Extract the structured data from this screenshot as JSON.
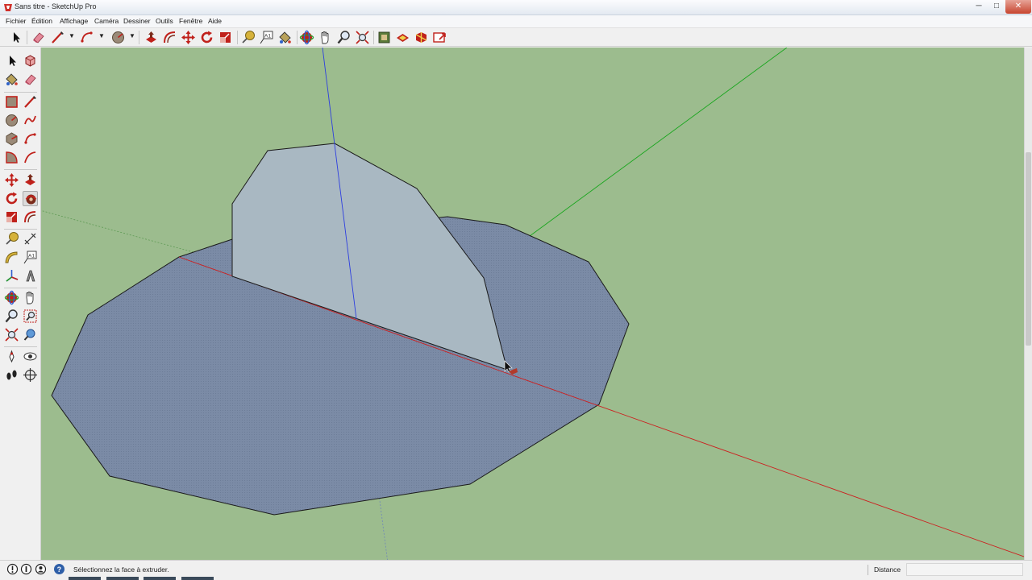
{
  "window": {
    "title": "Sans titre - SketchUp Pro",
    "min_glyph": "─",
    "max_glyph": "□",
    "close_glyph": "✕"
  },
  "menu": {
    "items": [
      {
        "label": "Fichier"
      },
      {
        "label": "Édition"
      },
      {
        "label": "Affichage"
      },
      {
        "label": "Caméra"
      },
      {
        "label": "Dessiner"
      },
      {
        "label": "Outils"
      },
      {
        "label": "Fenêtre"
      },
      {
        "label": "Aide"
      }
    ]
  },
  "toolbar": {
    "tools": [
      {
        "name": "select-tool-icon"
      },
      {
        "name": "eraser-icon"
      },
      {
        "name": "line-tool-icon"
      },
      {
        "name": "line-dropdown-icon"
      },
      {
        "name": "arc-tool-icon"
      },
      {
        "name": "arc-dropdown-icon"
      },
      {
        "name": "shape-tool-icon"
      },
      {
        "name": "shape-dropdown-icon"
      },
      {
        "name": "push-pull-icon"
      },
      {
        "name": "offset-icon"
      },
      {
        "name": "move-icon"
      },
      {
        "name": "rotate-icon"
      },
      {
        "name": "scale-icon"
      },
      {
        "name": "tape-measure-icon"
      },
      {
        "name": "text-icon"
      },
      {
        "name": "paint-bucket-icon"
      },
      {
        "name": "orbit-icon"
      },
      {
        "name": "pan-icon"
      },
      {
        "name": "zoom-icon"
      },
      {
        "name": "zoom-extents-icon"
      },
      {
        "name": "warehouse-icon"
      },
      {
        "name": "share-model-icon"
      },
      {
        "name": "extension-warehouse-icon"
      },
      {
        "name": "layout-send-icon"
      }
    ]
  },
  "status": {
    "message": "Sélectionnez la face à extruder.",
    "vcb_label": "Distance",
    "vcb_value": ""
  },
  "colors": {
    "viewport_bg": "#9cbc8e",
    "face_blue": "#7a8aa6",
    "face_light": "#a9b8c2",
    "axis_red": "#cc1f1f",
    "axis_green": "#19a61e",
    "axis_blue": "#2d3ee0",
    "edge_black": "#1a1a1a"
  }
}
